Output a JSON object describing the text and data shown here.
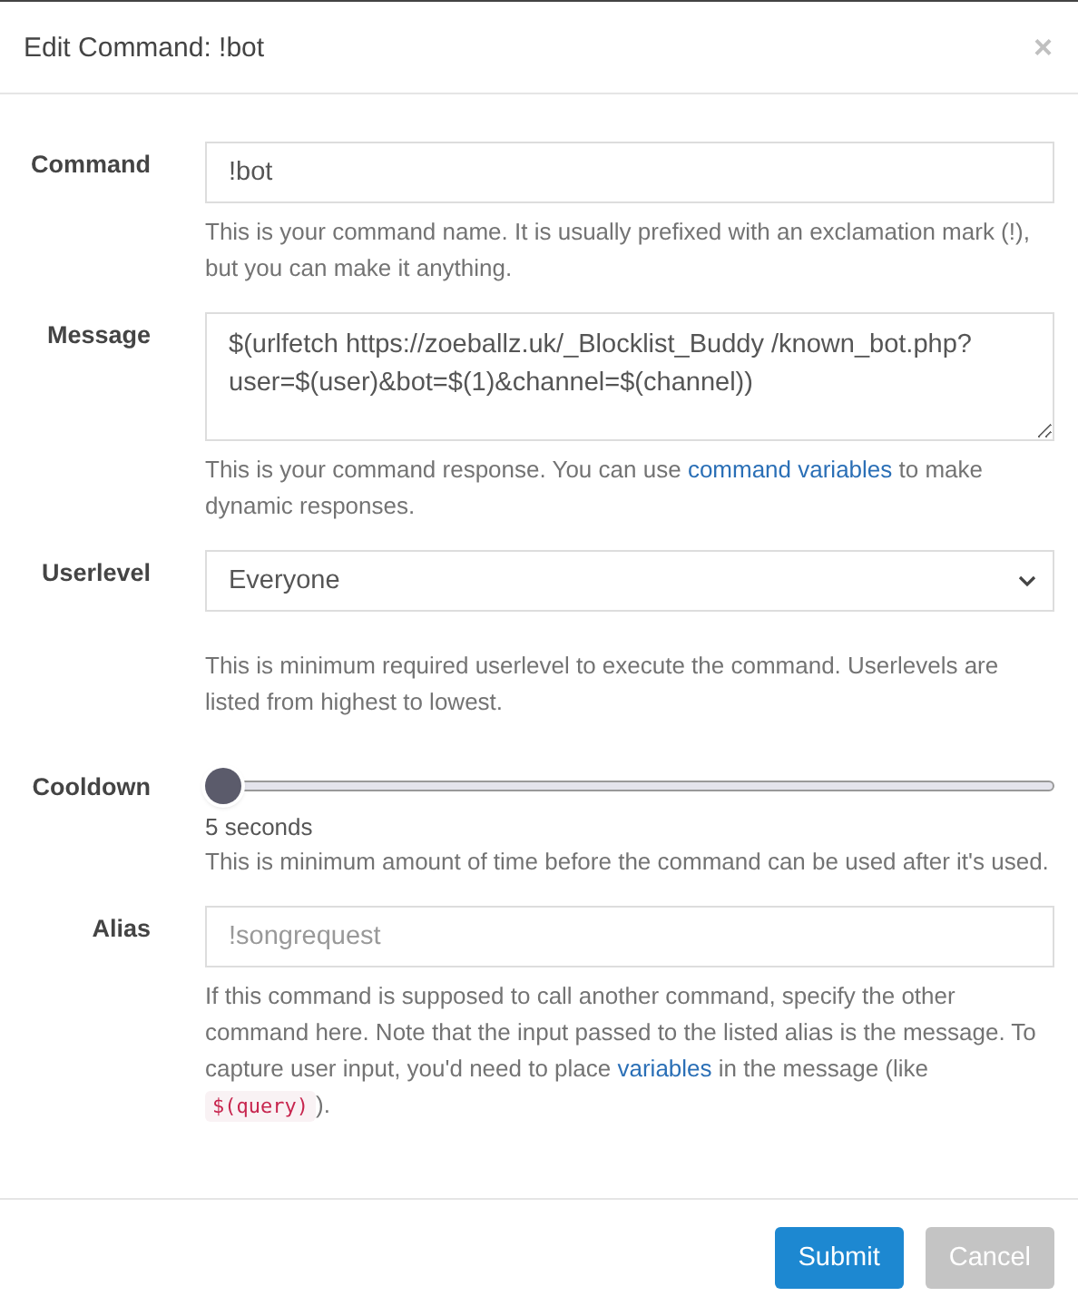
{
  "dialog": {
    "title": "Edit Command: !bot",
    "close": "×"
  },
  "fields": [
    {
      "kind": "input",
      "label": "Command",
      "value": "!bot",
      "help": [
        {
          "kind": "text",
          "text": "This is your command name. It is usually prefixed with an exclamation mark (!), but you can make it anything."
        }
      ]
    },
    {
      "kind": "textarea",
      "label": "Message",
      "value": "$(urlfetch https://zoeballz.uk/_Blocklist_Buddy /known_bot.php?user=$(user)&bot=$(1)&channel=$(channel))",
      "help": [
        {
          "kind": "text",
          "text": "This is your command response. You can use "
        },
        {
          "kind": "link",
          "text": "command variables"
        },
        {
          "kind": "text",
          "text": " to make dynamic responses."
        }
      ]
    },
    {
      "kind": "select",
      "label": "Userlevel",
      "value": "Everyone",
      "help": [
        {
          "kind": "text",
          "text": "This is minimum required userlevel to execute the command. Userlevels are listed from highest to lowest."
        }
      ]
    },
    {
      "kind": "slider",
      "label": "Cooldown",
      "level": 0,
      "reading": "5 seconds",
      "help": [
        {
          "kind": "text",
          "text": "This is minimum amount of time before the command can be used after it's used."
        }
      ]
    },
    {
      "kind": "input",
      "label": "Alias",
      "placeholder": "!songrequest",
      "help": [
        {
          "kind": "text",
          "text": "If this command is supposed to call another command, specify the other command here. Note that the input passed to the listed alias is the message. To capture user input, you'd need to place "
        },
        {
          "kind": "link",
          "text": "variables"
        },
        {
          "kind": "text",
          "text": " in the message (like "
        },
        {
          "kind": "code",
          "text": "$(query)"
        },
        {
          "kind": "text",
          "text": ")."
        }
      ]
    }
  ],
  "buttons": [
    {
      "kind": "primary",
      "label": "Submit",
      "disabled": false
    },
    {
      "kind": "secondary",
      "label": "Cancel",
      "disabled": true
    }
  ]
}
